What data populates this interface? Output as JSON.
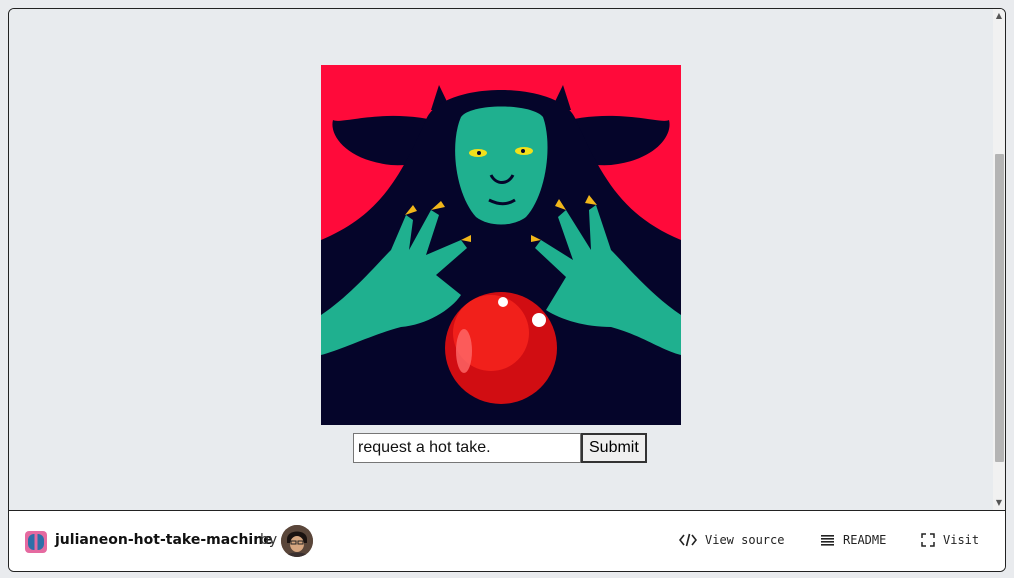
{
  "app": {
    "prompt_input": {
      "value": "request a hot take.",
      "placeholder": ""
    },
    "submit_label": "Submit"
  },
  "footer": {
    "project_name": "julianeon-hot-take-machine",
    "by_label": "by",
    "actions": {
      "view_source": "View source",
      "readme": "README",
      "visit": "Visit"
    }
  },
  "colors": {
    "art_background": "#ff0a3a",
    "figure_dark": "#05052a",
    "skin_teal": "#1fb08f",
    "orb_red": "#d10d12",
    "nail_gold": "#f2b71a"
  },
  "icons": {
    "scroll_up": "triangle-up",
    "scroll_down": "triangle-down",
    "view_source": "code-icon",
    "readme": "list-icon",
    "visit": "fullscreen-icon"
  }
}
